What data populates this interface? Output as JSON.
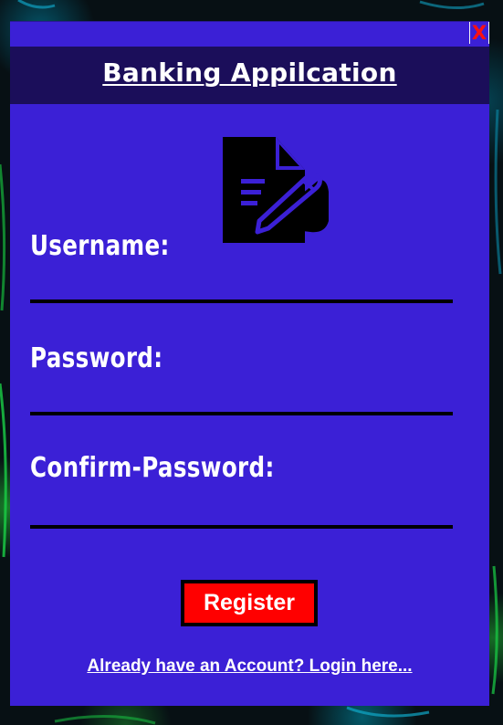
{
  "window": {
    "close_label": "X"
  },
  "header": {
    "title": "Banking Appilcation"
  },
  "icon": {
    "name": "register-document-pen-icon"
  },
  "form": {
    "username": {
      "label": "Username:",
      "value": ""
    },
    "password": {
      "label": "Password:",
      "value": ""
    },
    "confirm_password": {
      "label": "Confirm-Password:",
      "value": ""
    }
  },
  "actions": {
    "register_label": "Register",
    "login_link": "Already have an Account? Login here..."
  },
  "colors": {
    "window_bg": "#3b20d6",
    "title_bar_bg": "#1b0e5a",
    "button_bg": "#ff0000",
    "close_x": "#ff1010"
  }
}
